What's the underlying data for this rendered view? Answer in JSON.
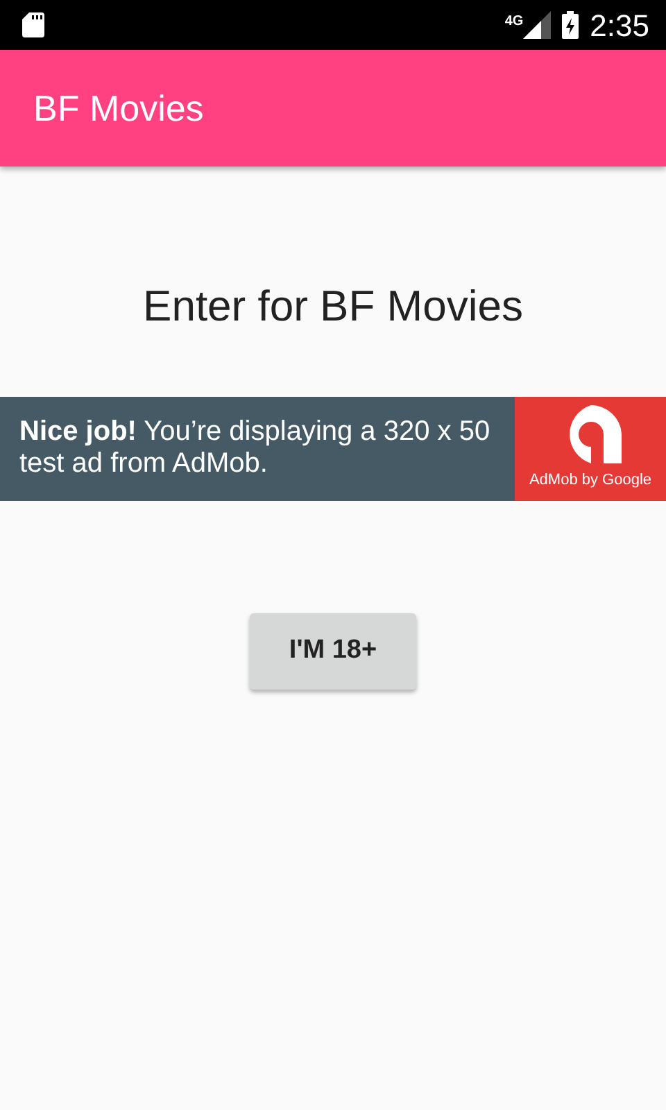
{
  "status_bar": {
    "network": "4G",
    "time": "2:35"
  },
  "app_bar": {
    "title": "BF Movies"
  },
  "heading": "Enter for BF Movies",
  "ad": {
    "message": "**Nice job!** You’re displaying a 320 x 50 test ad from AdMob.",
    "brand": "AdMob by Google"
  },
  "buttons": [
    "I'M 18+"
  ]
}
